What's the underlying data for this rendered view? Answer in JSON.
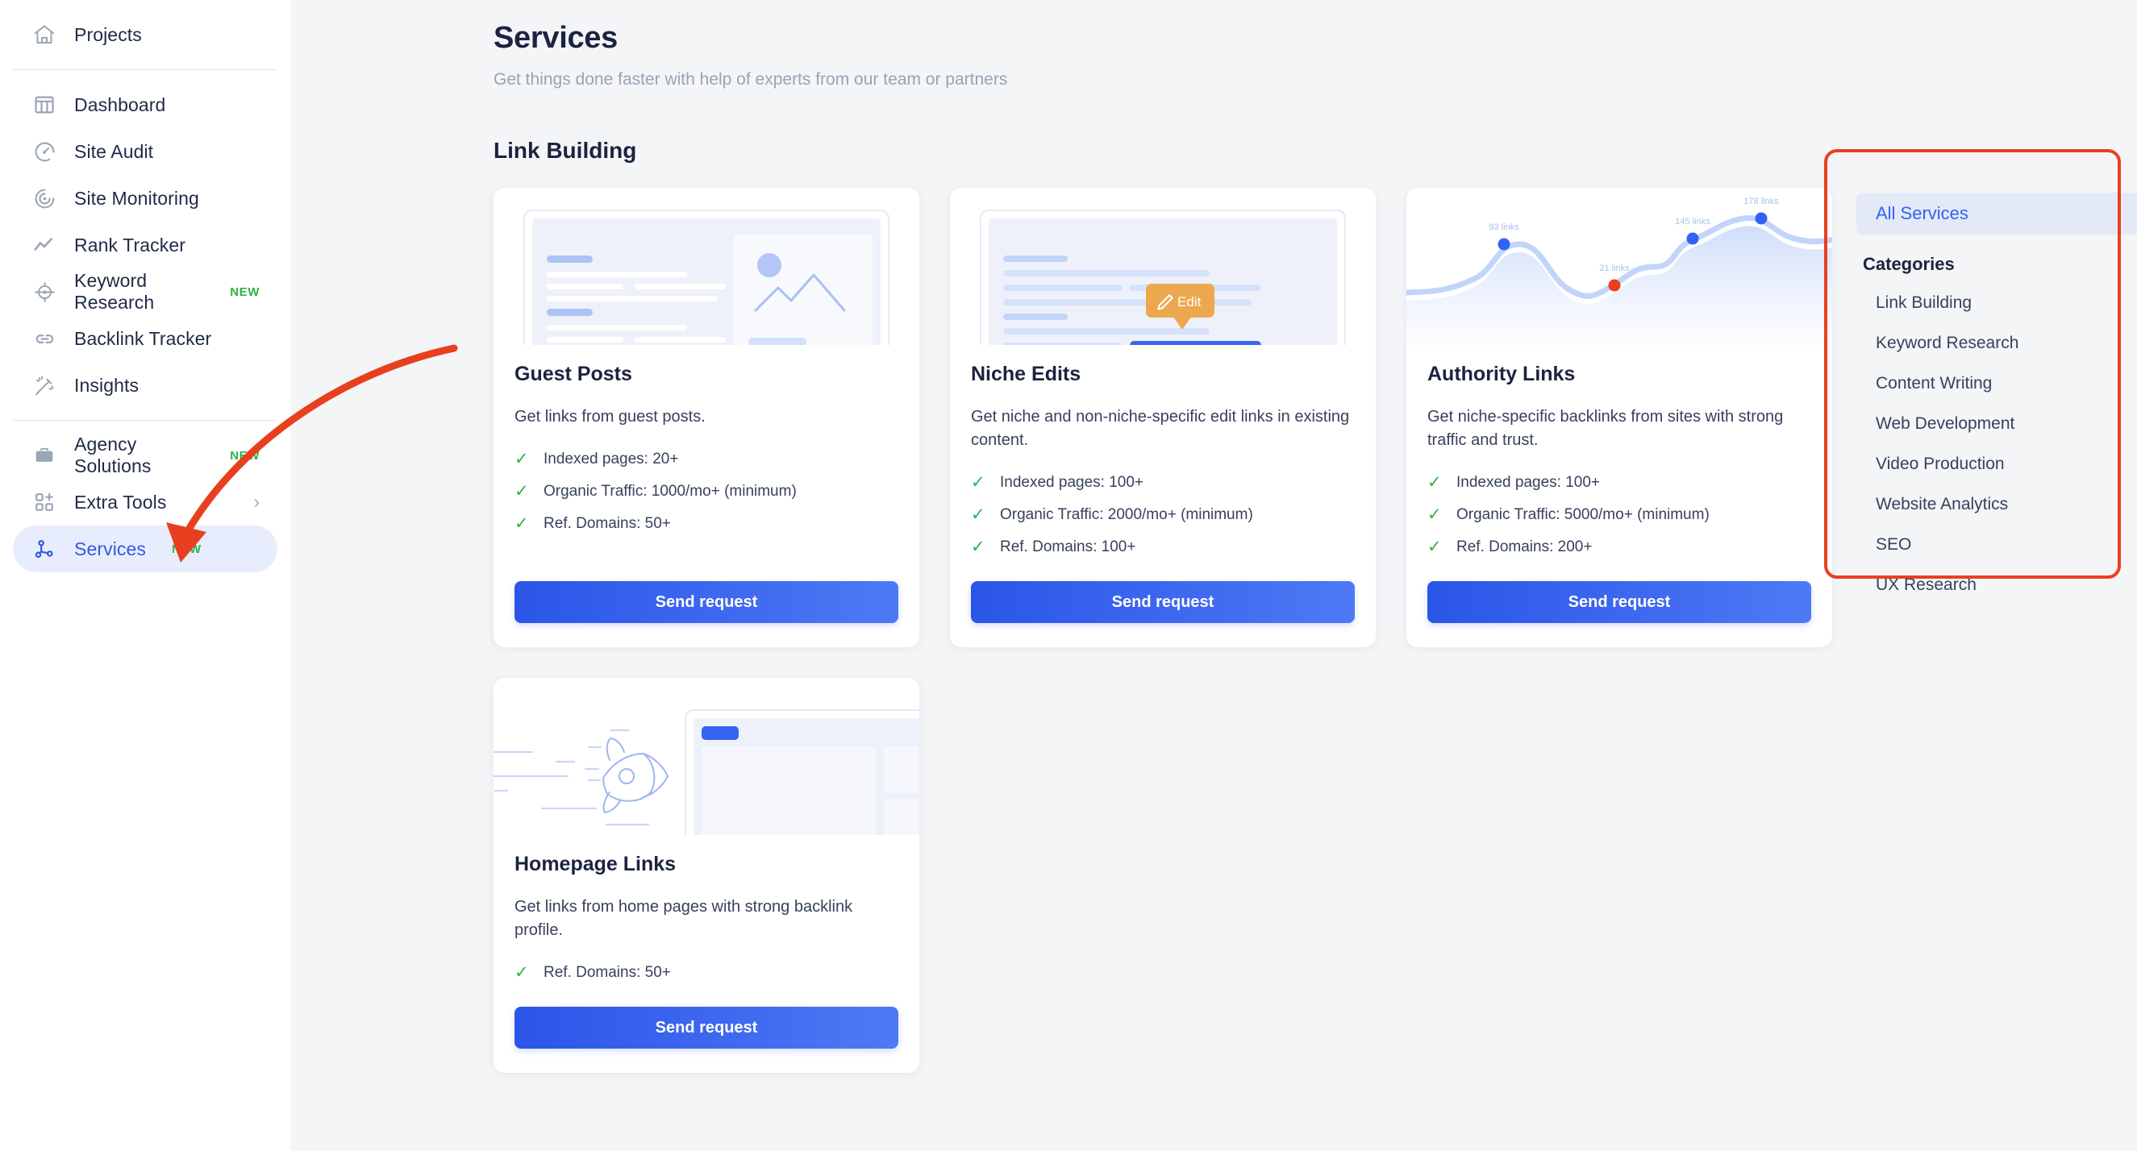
{
  "sidebar": {
    "top_item": {
      "label": "Projects",
      "icon": "home-icon"
    },
    "items": [
      {
        "label": "Dashboard",
        "icon": "dashboard-icon",
        "badge": "",
        "chevron": false,
        "active": false
      },
      {
        "label": "Site Audit",
        "icon": "gauge-icon",
        "badge": "",
        "chevron": false,
        "active": false
      },
      {
        "label": "Site Monitoring",
        "icon": "radar-icon",
        "badge": "",
        "chevron": false,
        "active": false
      },
      {
        "label": "Rank Tracker",
        "icon": "trendline-icon",
        "badge": "",
        "chevron": false,
        "active": false
      },
      {
        "label": "Keyword Research",
        "icon": "target-icon",
        "badge": "NEW",
        "chevron": false,
        "active": false
      },
      {
        "label": "Backlink Tracker",
        "icon": "link-icon",
        "badge": "",
        "chevron": false,
        "active": false
      },
      {
        "label": "Insights",
        "icon": "magic-wand-icon",
        "badge": "",
        "chevron": false,
        "active": false
      }
    ],
    "items2": [
      {
        "label": "Agency Solutions",
        "icon": "briefcase-icon",
        "badge": "NEW",
        "chevron": false,
        "active": false
      },
      {
        "label": "Extra Tools",
        "icon": "grid-plus-icon",
        "badge": "",
        "chevron": true,
        "active": false
      },
      {
        "label": "Services",
        "icon": "services-node-icon",
        "badge": "NEW",
        "chevron": false,
        "active": true
      }
    ],
    "chevron_glyph": "›"
  },
  "header": {
    "title": "Services",
    "subtitle": "Get things done faster with help of experts from our team or partners"
  },
  "section": {
    "title": "Link Building"
  },
  "cards": [
    {
      "title": "Guest Posts",
      "description": "Get links from guest posts.",
      "features": [
        "Indexed pages: 20+",
        "Organic Traffic: 1000/mo+ (minimum)",
        "Ref. Domains: 50+"
      ],
      "cta": "Send request",
      "illustration": "article-with-image-illustration"
    },
    {
      "title": "Niche Edits",
      "description": "Get niche and non-niche-specific edit links in existing content.",
      "features": [
        "Indexed pages: 100+",
        "Organic Traffic: 2000/mo+ (minimum)",
        "Ref. Domains: 100+"
      ],
      "cta": "Send request",
      "illustration": "article-with-edit-tooltip-illustration",
      "tooltip_label": "Edit"
    },
    {
      "title": "Authority Links",
      "description": "Get niche-specific backlinks from sites with strong traffic and trust.",
      "features": [
        "Indexed pages: 100+",
        "Organic Traffic: 5000/mo+ (minimum)",
        "Ref. Domains: 200+"
      ],
      "cta": "Send request",
      "illustration": "links-growth-chart-illustration"
    },
    {
      "title": "Homepage Links",
      "description": "Get links from home pages with strong backlink profile.",
      "features": [
        "Ref. Domains: 50+"
      ],
      "cta": "Send request",
      "illustration": "rocket-and-browser-illustration"
    }
  ],
  "chart_data": {
    "type": "line",
    "title": "",
    "x": [
      1,
      2,
      3,
      4
    ],
    "point_labels": [
      "93 links",
      "21 links",
      "145 links",
      "178 links"
    ],
    "values": [
      93,
      21,
      145,
      178
    ],
    "point_colors": [
      "#2f62f5",
      "#e8401f",
      "#2f62f5",
      "#2f62f5"
    ],
    "xlabel": "",
    "ylabel": "",
    "grid": false,
    "legend": "none"
  },
  "categories_panel": {
    "all_services": "All Services",
    "heading": "Categories",
    "items": [
      "Link Building",
      "Keyword Research",
      "Content Writing",
      "Web Development",
      "Video Production",
      "Website Analytics",
      "SEO",
      "UX Research"
    ]
  },
  "colors": {
    "accent_blue": "#2f62f5",
    "brand_blue_dark": "#2b55e8",
    "brand_blue_light": "#4e79f5",
    "green_new": "#2bb34a",
    "annotation_red": "#e8401f",
    "page_bg": "#f4f5f7",
    "text_dark": "#1b2340",
    "text_muted": "#9aa3b2",
    "tooltip_orange": "#eda84f"
  }
}
